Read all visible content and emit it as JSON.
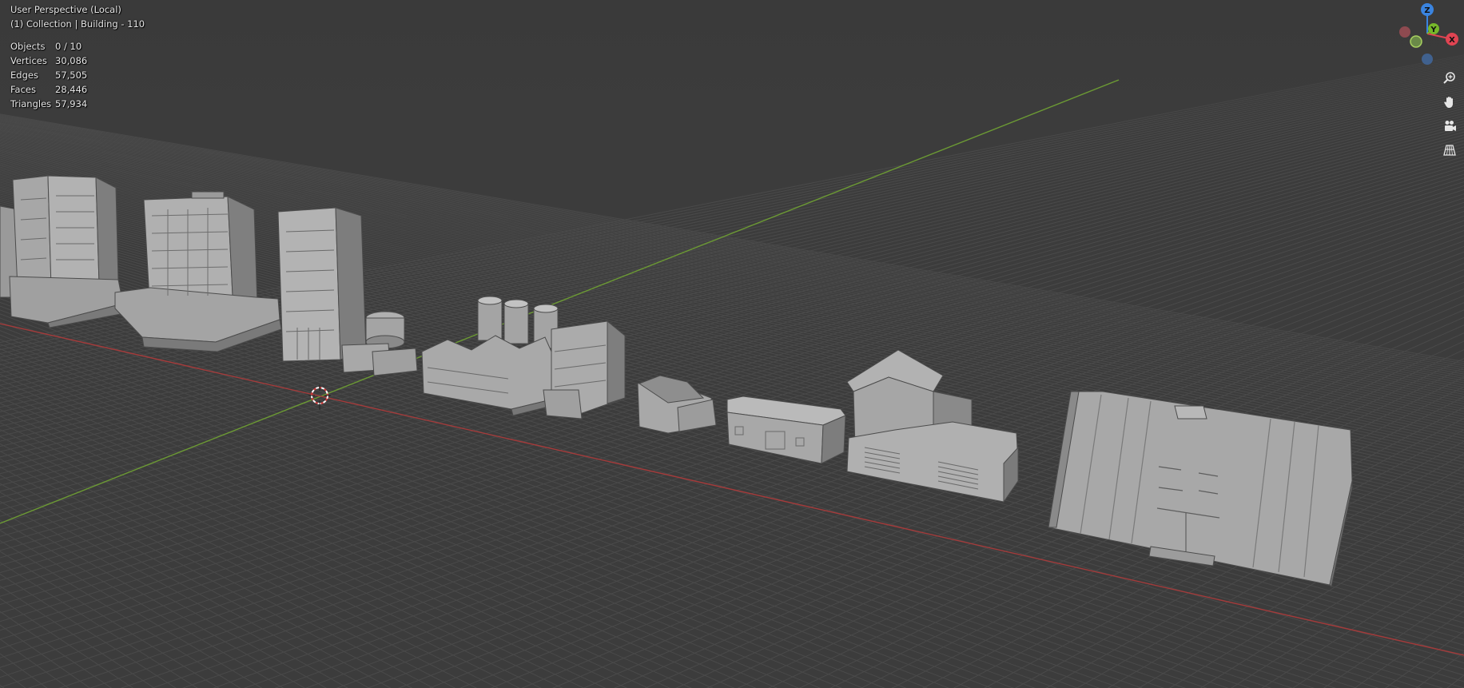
{
  "viewport": {
    "view_name": "User Perspective (Local)",
    "collection_line": "(1) Collection | Building - 110",
    "stats": [
      {
        "label": "Objects",
        "value": "0 / 10"
      },
      {
        "label": "Vertices",
        "value": "30,086"
      },
      {
        "label": "Edges",
        "value": "57,505"
      },
      {
        "label": "Faces",
        "value": "28,446"
      },
      {
        "label": "Triangles",
        "value": "57,934"
      }
    ]
  },
  "gizmo": {
    "x_label": "X",
    "y_label": "Y",
    "z_label": "Z",
    "colors": {
      "x": "#e04452",
      "y": "#76b82a",
      "z": "#3a84e0",
      "neg_x": "#8e4a50",
      "neg_y": "#6a8a48",
      "neg_z": "#40618e"
    }
  },
  "nav_tools": [
    {
      "name": "zoom-icon"
    },
    {
      "name": "hand-pan-icon"
    },
    {
      "name": "camera-icon"
    },
    {
      "name": "grid-perspective-icon"
    }
  ],
  "scene": {
    "colors": {
      "background": "#3c3c3c",
      "grid": "#4b4b4b",
      "x_axis": "#a83a3a",
      "y_axis": "#6a9a2e",
      "building": "#a8a8a8",
      "building_dark": "#7c7c7c",
      "building_shadow": "#5e5e5e"
    }
  }
}
